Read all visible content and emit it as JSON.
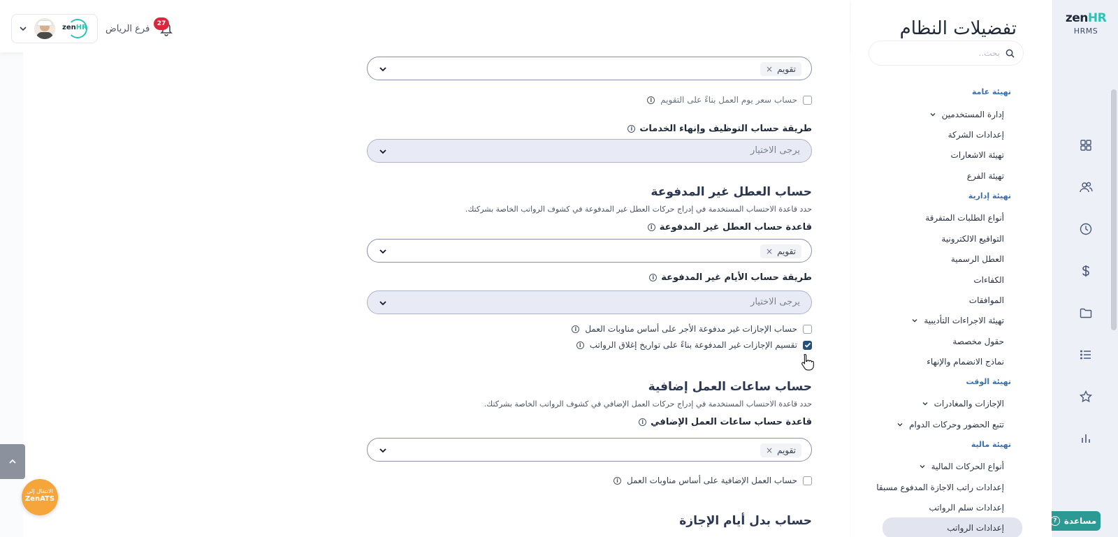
{
  "rail": {
    "logo_zen": "zen",
    "logo_hr": "HR",
    "logo_sub": "HRMS",
    "icons": [
      "grid-icon",
      "users-icon",
      "clock-icon",
      "dollar-icon",
      "folder-icon",
      "list-icon",
      "star-icon",
      "bar-chart-icon"
    ],
    "help_label": "مساعدة"
  },
  "sidebar": {
    "title": "تفضيلات النظام",
    "search_placeholder": "بحث..",
    "sections": [
      {
        "title": "تهيئة عامة",
        "items": [
          {
            "label": "إدارة المستخدمين",
            "expandable": true
          },
          {
            "label": "إعدادات الشركة",
            "expandable": false
          },
          {
            "label": "تهيئة الاشعارات",
            "expandable": false
          },
          {
            "label": "تهيئة الفرع",
            "expandable": false
          }
        ]
      },
      {
        "title": "تهيئة إدارية",
        "items": [
          {
            "label": "أنواع الطلبات المتفرقة",
            "expandable": false
          },
          {
            "label": "التواقيع الالكترونية",
            "expandable": false
          },
          {
            "label": "العطل الرسمية",
            "expandable": false
          },
          {
            "label": "الكفاءات",
            "expandable": false
          },
          {
            "label": "الموافقات",
            "expandable": false
          },
          {
            "label": "تهيئة الاجراءات التأديبية",
            "expandable": true
          },
          {
            "label": "حقول مخصصة",
            "expandable": false
          },
          {
            "label": "نماذج الانضمام والإنهاء",
            "expandable": false
          }
        ]
      },
      {
        "title": "تهيئة الوقت",
        "items": [
          {
            "label": "الإجازات والمغادرات",
            "expandable": true
          },
          {
            "label": "تتبع الحضور وحركات الدوام",
            "expandable": true
          }
        ]
      },
      {
        "title": "تهيئة مالية",
        "items": [
          {
            "label": "أنواع الحركات المالية",
            "expandable": true
          },
          {
            "label": "إعدادات راتب الاجازة المدفوع مسبقا",
            "expandable": false
          },
          {
            "label": "إعدادات سلم الرواتب",
            "expandable": false
          },
          {
            "label": "إعدادات الرواتب",
            "expandable": false,
            "active": true
          }
        ]
      }
    ]
  },
  "header": {
    "branch": "فرع الرياض",
    "notifications": "27",
    "company_logo_zen": "zen",
    "company_logo_hr": "HR"
  },
  "form": {
    "calendar_select_1": {
      "chip": "تقويم"
    },
    "daily_rate_check": {
      "label": "حساب سعر يوم العمل بناءً على التقويم",
      "checked": false
    },
    "hiring_method": {
      "label": "طريقة حساب التوظيف وإنهاء الخدمات",
      "placeholder": "يرجى الاختيار"
    },
    "unpaid_section": {
      "title": "حساب العطل غير المدفوعة",
      "desc": "حدد قاعدة الاحتساب المستخدمة في إدراج حركات العطل غير المدفوعة في كشوف الرواتب الخاصة بشركتك."
    },
    "unpaid_rule": {
      "label": "قاعدة حساب العطل غير المدفوعة",
      "chip": "تقويم"
    },
    "unpaid_days_method": {
      "label": "طريقة حساب الأيام غير المدفوعة",
      "placeholder": "يرجى الاختيار"
    },
    "unpaid_shift_check": {
      "label": "حساب الإجازات غير مدفوعة الأجر على أساس مناوبات العمل",
      "checked": false
    },
    "unpaid_split_check": {
      "label": "تقسيم الإجازات غير المدفوعة بناءً على تواريخ إغلاق الرواتب",
      "checked": true
    },
    "overtime_section": {
      "title": "حساب ساعات العمل إضافية",
      "desc": "حدد قاعدة الاحتساب المستخدمة في إدراج حركات العمل الإضافي في كشوف الرواتب الخاصة بشركتك."
    },
    "overtime_rule": {
      "label": "قاعدة حساب ساعات العمل الإضافي",
      "chip": "تقويم"
    },
    "overtime_shift_check": {
      "label": "حساب العمل الإضافية على أساس مناوبات العمل",
      "checked": false
    },
    "leave_allowance_section": {
      "title": "حساب بدل أيام الإجازة"
    }
  },
  "ats": {
    "line1": "الانتقال إلى",
    "line2": "ZenATS"
  },
  "colors": {
    "accent": "#28507d",
    "teal": "#2c9a94",
    "badge": "#d9283e",
    "ats": "#f6a53a",
    "section_head": "#3b6fb2"
  }
}
